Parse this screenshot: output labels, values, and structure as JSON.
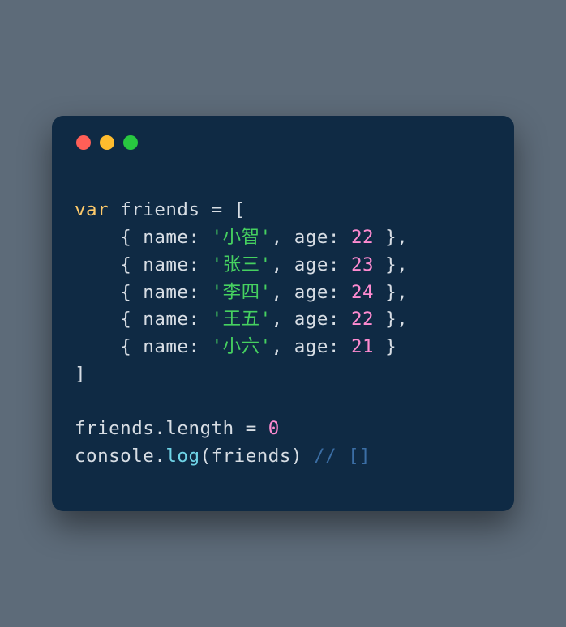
{
  "code": {
    "keyword_var": "var",
    "ident_friends": "friends",
    "op_eq": "=",
    "bracket_open": "[",
    "brace_open": "{",
    "key_name": "name",
    "colon": ":",
    "comma_sp": ",",
    "key_age": "age",
    "brace_close": "}",
    "bracket_close": "]",
    "friends": [
      {
        "name": "'小智'",
        "age": "22"
      },
      {
        "name": "'张三'",
        "age": "23"
      },
      {
        "name": "'李四'",
        "age": "24"
      },
      {
        "name": "'王五'",
        "age": "22"
      },
      {
        "name": "'小六'",
        "age": "21"
      }
    ],
    "dot": ".",
    "ident_length": "length",
    "zero": "0",
    "ident_console": "console",
    "ident_log": "log",
    "paren_open": "(",
    "paren_close": ")",
    "comment": "// []"
  }
}
